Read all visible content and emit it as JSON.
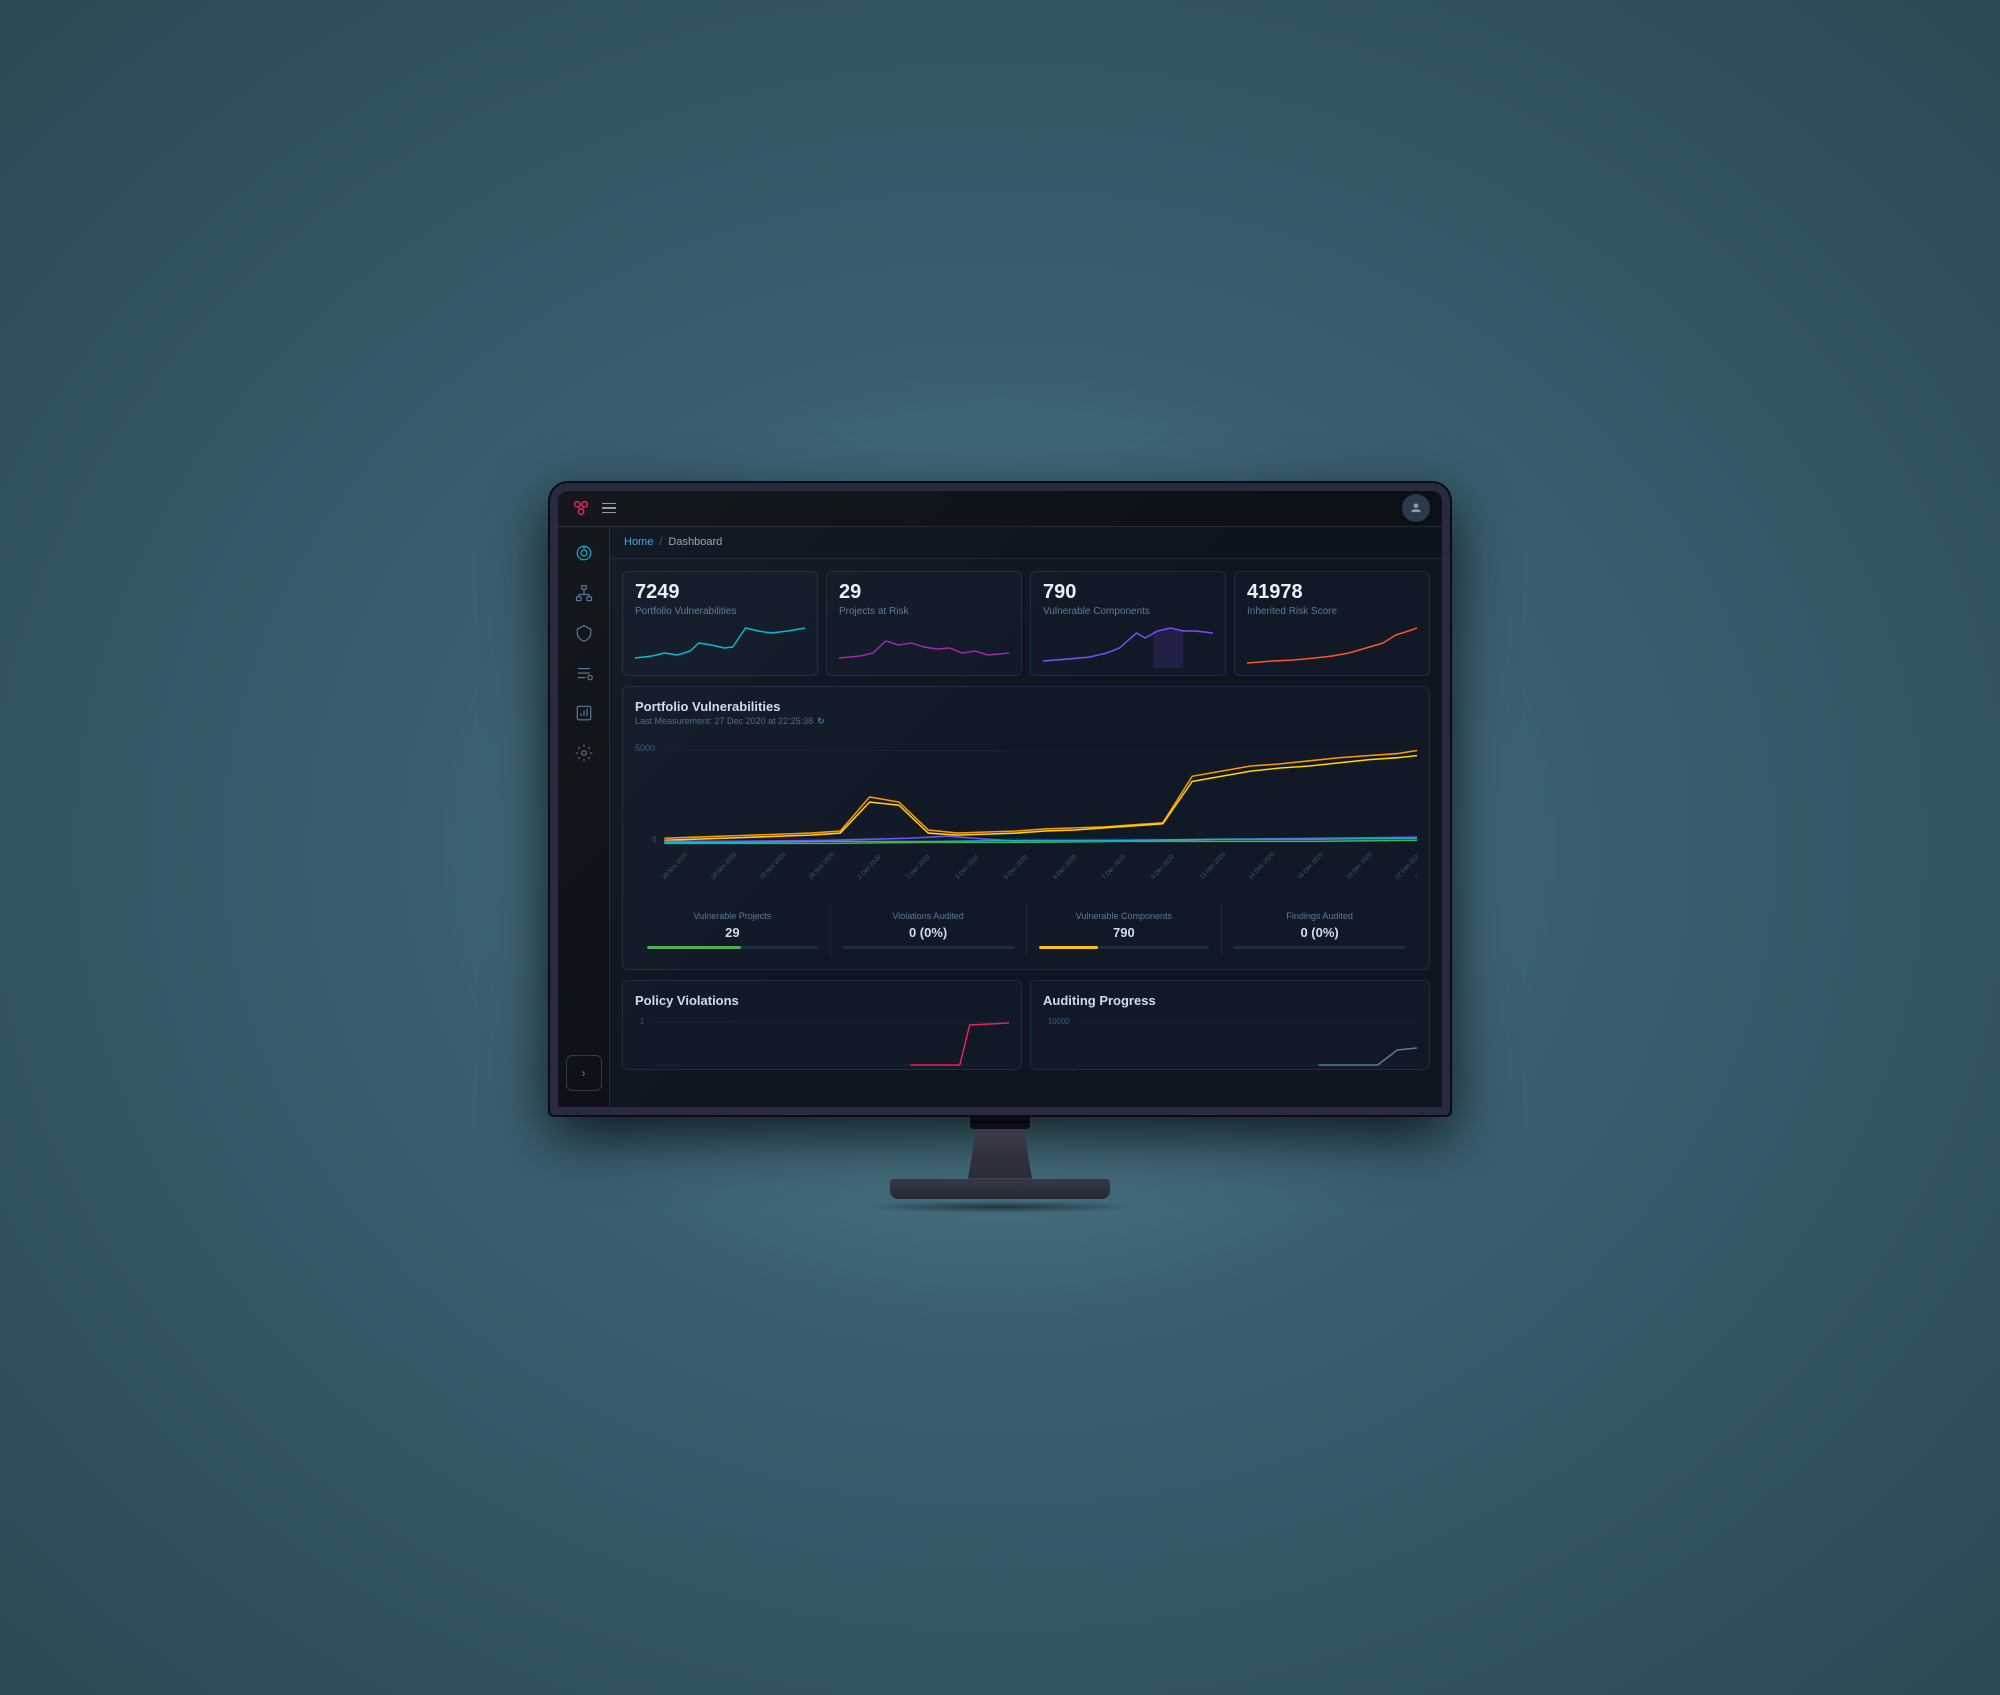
{
  "topbar": {
    "hamburger_label": "menu",
    "user_icon": "👤"
  },
  "breadcrumb": {
    "home": "Home",
    "separator": "/",
    "current": "Dashboard"
  },
  "metrics": [
    {
      "id": "portfolio-vulnerabilities",
      "value": "7249",
      "label": "Portfolio Vulnerabilities",
      "chart_color": "#00bcd4",
      "chart_type": "line"
    },
    {
      "id": "projects-at-risk",
      "value": "29",
      "label": "Projects at Risk",
      "chart_color": "#9c27b0",
      "chart_type": "line"
    },
    {
      "id": "vulnerable-components",
      "value": "790",
      "label": "Vulnerable Components",
      "chart_color": "#7c4dff",
      "chart_type": "line"
    },
    {
      "id": "inherited-risk-score",
      "value": "41978",
      "label": "Inherited Risk Score",
      "chart_color": "#ff5722",
      "chart_type": "line"
    }
  ],
  "portfolio_section": {
    "title": "Portfolio Vulnerabilities",
    "subtitle": "Last Measurement: 27 Dec 2020 at 22:25:38",
    "refresh_icon": "↻",
    "y_label": "5000",
    "y_label_zero": "0"
  },
  "stats": [
    {
      "label": "Vulnerable Projects",
      "value": "29",
      "bar_color": "#4caf50",
      "bar_fill": 55
    },
    {
      "label": "Violations Audited",
      "value": "0 (0%)",
      "bar_color": "#3a5a7a",
      "bar_fill": 0
    },
    {
      "label": "Vulnerable Components",
      "value": "790",
      "bar_color": "#ffc107",
      "bar_fill": 35
    },
    {
      "label": "Findings Audited",
      "value": "0 (0%)",
      "bar_color": "#3a5a7a",
      "bar_fill": 0
    }
  ],
  "bottom_cards": [
    {
      "title": "Policy Violations",
      "y_label": "1",
      "chart_color": "#e91e63"
    },
    {
      "title": "Auditing Progress",
      "y_label": "10000",
      "chart_color": "#607d8b"
    }
  ],
  "sidebar": {
    "items": [
      {
        "id": "dashboard",
        "icon": "dashboard",
        "active": true
      },
      {
        "id": "organization",
        "icon": "org"
      },
      {
        "id": "vulnerabilities",
        "icon": "bug"
      },
      {
        "id": "policy",
        "icon": "policy"
      },
      {
        "id": "reports",
        "icon": "reports"
      },
      {
        "id": "settings",
        "icon": "settings"
      }
    ],
    "expand_label": "›"
  }
}
